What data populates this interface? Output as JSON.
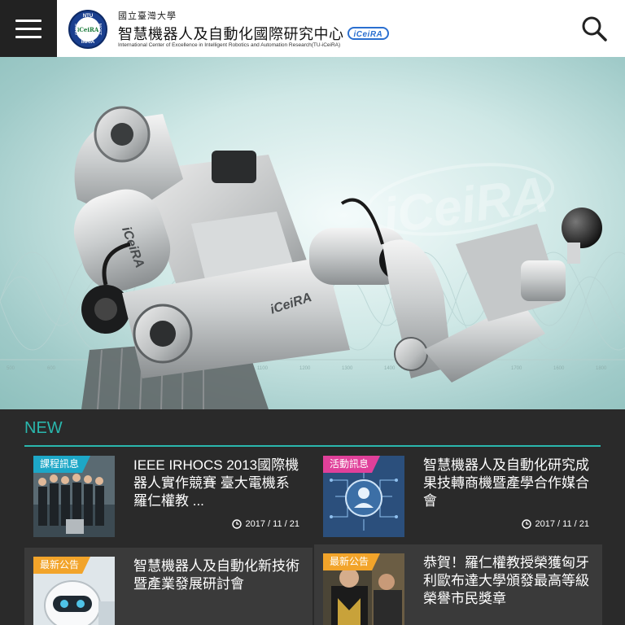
{
  "header": {
    "univ_name": "國立臺灣大學",
    "center_name": "智慧機器人及自動化國際研究中心",
    "center_mark": "iCeiRA",
    "center_subtitle": "International Center of Excellence in Intelligent Robotics and Automation Research(TU-iCeiRA)",
    "seal": {
      "top": "NTU",
      "bottom": "INRIA",
      "left": "CNRS",
      "right": "MOST",
      "center": "iCeiRA"
    },
    "icons": {
      "menu": "hamburger-menu-icon",
      "search": "search-icon"
    }
  },
  "hero": {
    "watermark": "iCeiRA",
    "arm_label_1": "iCeiRA",
    "arm_label_2": "iCeiRA",
    "ticks": [
      "500",
      "600",
      "1100",
      "1200",
      "1300",
      "1400",
      "1700",
      "1600",
      "1800"
    ]
  },
  "news": {
    "heading": "NEW",
    "accent_color": "#2ab7ad",
    "items": [
      {
        "tag": "課程訊息",
        "tag_color": "#1da7c7",
        "title": "IEEE IRHOCS 2013國際機器人實作競賽 臺大電機系羅仁權教 ...",
        "date": "2017 / 11 / 21"
      },
      {
        "tag": "活動訊息",
        "tag_color": "#e0409a",
        "title": "智慧機器人及自動化研究成果技轉商機暨產學合作媒合會",
        "date": "2017 / 11 / 21"
      },
      {
        "tag": "最新公告",
        "tag_color": "#f2a42a",
        "title": "智慧機器人及自動化新技術暨產業發展研討會",
        "date": ""
      },
      {
        "tag": "最新公告",
        "tag_color": "#f2a42a",
        "title": "恭賀！羅仁權教授榮獲匈牙利歐布達大學頒發最高等級榮譽市民獎章",
        "date": ""
      }
    ]
  }
}
